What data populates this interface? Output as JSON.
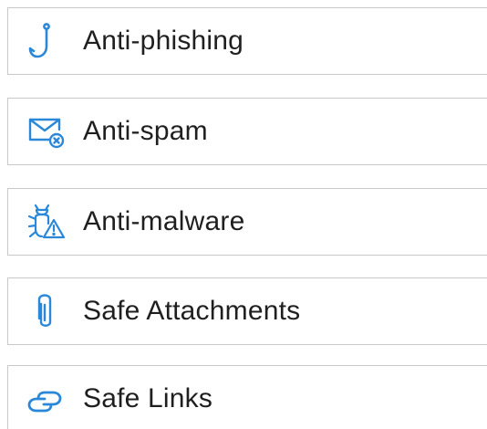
{
  "accent_color": "#2b88d8",
  "policies": [
    {
      "label": "Anti-phishing",
      "icon": "fishing-hook-icon"
    },
    {
      "label": "Anti-spam",
      "icon": "mail-blocked-icon"
    },
    {
      "label": "Anti-malware",
      "icon": "bug-warning-icon"
    },
    {
      "label": "Safe Attachments",
      "icon": "paperclip-icon"
    },
    {
      "label": "Safe Links",
      "icon": "link-icon"
    }
  ]
}
